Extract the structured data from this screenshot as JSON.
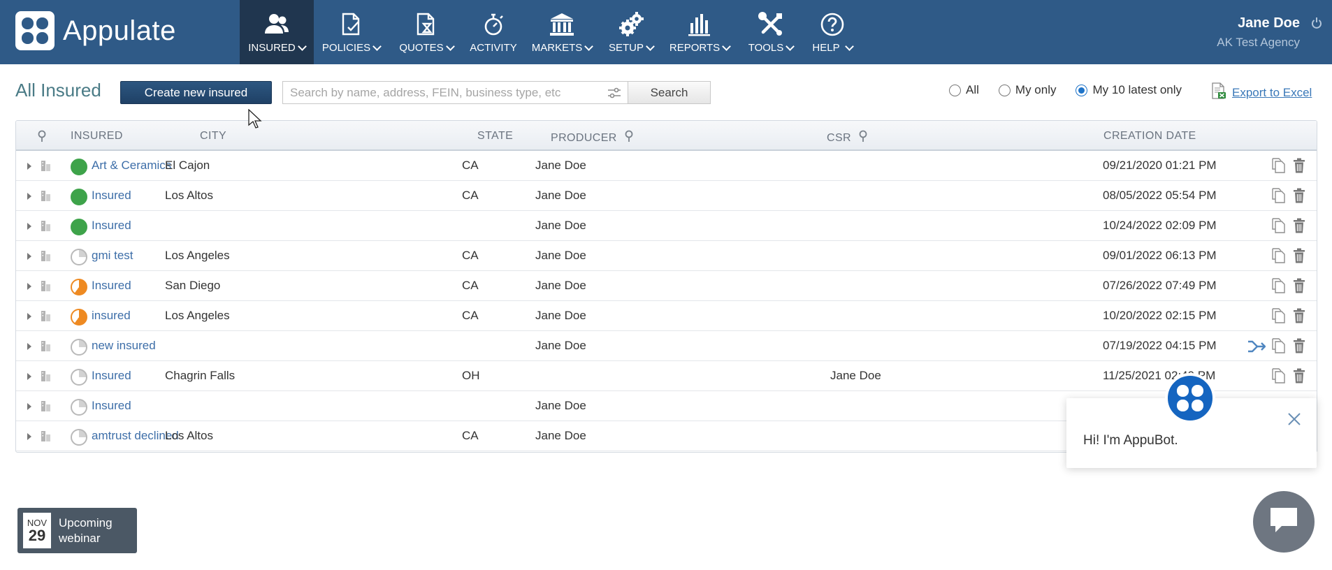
{
  "app": {
    "name": "Appulate"
  },
  "nav": [
    {
      "label": "INSURED",
      "icon": "people-icon",
      "active": true,
      "has_dropdown": true
    },
    {
      "label": "POLICIES",
      "icon": "policy-icon",
      "active": false,
      "has_dropdown": true
    },
    {
      "label": "QUOTES",
      "icon": "quote-icon",
      "active": false,
      "has_dropdown": true
    },
    {
      "label": "ACTIVITY",
      "icon": "stopwatch-icon",
      "active": false,
      "has_dropdown": false
    },
    {
      "label": "MARKETS",
      "icon": "bank-icon",
      "active": false,
      "has_dropdown": true
    },
    {
      "label": "SETUP",
      "icon": "gears-icon",
      "active": false,
      "has_dropdown": true
    },
    {
      "label": "REPORTS",
      "icon": "bar-chart-icon",
      "active": false,
      "has_dropdown": true
    },
    {
      "label": "TOOLS",
      "icon": "tools-icon",
      "active": false,
      "has_dropdown": true
    },
    {
      "label": "HELP",
      "icon": "help-icon",
      "active": false,
      "has_dropdown": true
    }
  ],
  "user": {
    "name": "Jane Doe",
    "agency": "AK Test Agency"
  },
  "toolbar": {
    "title": "All Insured",
    "create_label": "Create new insured",
    "search_placeholder": "Search by name, address, FEIN, business type, etc",
    "search_value": "",
    "search_label": "Search",
    "filters": [
      {
        "label": "All",
        "selected": false
      },
      {
        "label": "My only",
        "selected": false
      },
      {
        "label": "My 10 latest only",
        "selected": true
      }
    ],
    "export_label": "Export to Excel"
  },
  "table": {
    "columns": {
      "insured": "INSURED",
      "city": "CITY",
      "state": "STATE",
      "producer": "PRODUCER",
      "csr": "CSR",
      "created": "CREATION DATE"
    },
    "rows": [
      {
        "status": "green",
        "insured": "Art & Ceramics",
        "city": "El Cajon",
        "state": "CA",
        "producer": "Jane Doe",
        "csr": "",
        "created": "09/21/2020 01:21 PM",
        "assign": false
      },
      {
        "status": "green",
        "insured": "Insured",
        "city": "Los Altos",
        "state": "CA",
        "producer": "Jane Doe",
        "csr": "",
        "created": "08/05/2022 05:54 PM",
        "assign": false
      },
      {
        "status": "green",
        "insured": "Insured",
        "city": "",
        "state": "",
        "producer": "Jane Doe",
        "csr": "",
        "created": "10/24/2022 02:09 PM",
        "assign": false
      },
      {
        "status": "gray",
        "insured": "gmi test",
        "city": "Los Angeles",
        "state": "CA",
        "producer": "Jane Doe",
        "csr": "",
        "created": "09/01/2022 06:13 PM",
        "assign": false
      },
      {
        "status": "orange",
        "insured": "Insured",
        "city": "San Diego",
        "state": "CA",
        "producer": "Jane Doe",
        "csr": "",
        "created": "07/26/2022 07:49 PM",
        "assign": false
      },
      {
        "status": "orange",
        "insured": "insured",
        "city": "Los Angeles",
        "state": "CA",
        "producer": "Jane Doe",
        "csr": "",
        "created": "10/20/2022 02:15 PM",
        "assign": false
      },
      {
        "status": "gray",
        "insured": "new insured",
        "city": "",
        "state": "",
        "producer": "Jane Doe",
        "csr": "",
        "created": "07/19/2022 04:15 PM",
        "assign": true
      },
      {
        "status": "gray",
        "insured": "Insured",
        "city": "Chagrin Falls",
        "state": "OH",
        "producer": "",
        "csr": "Jane Doe",
        "created": "11/25/2021 02:49 PM",
        "assign": false
      },
      {
        "status": "gray",
        "insured": "Insured",
        "city": "",
        "state": "",
        "producer": "Jane Doe",
        "csr": "",
        "created": "",
        "assign": false
      },
      {
        "status": "gray",
        "insured": "amtrust declined",
        "city": "Los Altos",
        "state": "CA",
        "producer": "Jane Doe",
        "csr": "",
        "created": "",
        "assign": false
      }
    ]
  },
  "bot": {
    "greeting": "Hi! I'm AppuBot."
  },
  "webinar": {
    "month": "NOV",
    "day": "29",
    "line1": "Upcoming",
    "line2": "webinar"
  },
  "colors": {
    "topbar": "#2f5a87",
    "active_tab": "#20364f",
    "link": "#3d6ea8",
    "status_green": "#3ea34a",
    "status_orange": "#ee8a22"
  }
}
